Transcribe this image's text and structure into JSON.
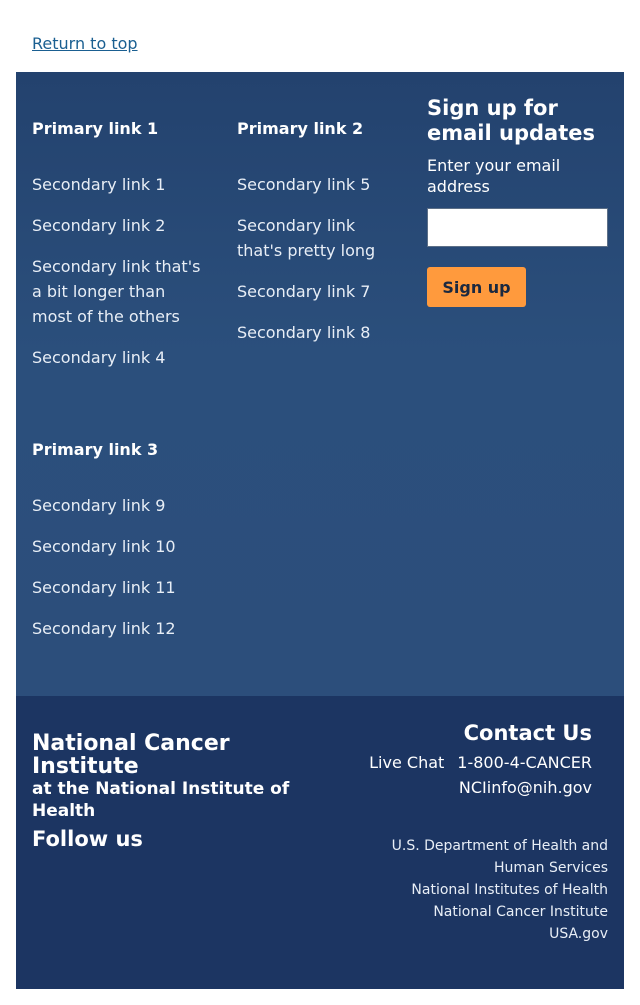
{
  "return_to_top": "Return to top",
  "nav": {
    "columns": [
      {
        "primary": "Primary link 1",
        "secondary": [
          "Secondary link 1",
          "Secondary link 2",
          "Secondary link that's a bit longer than most of the others",
          "Secondary link 4"
        ]
      },
      {
        "primary": "Primary link 2",
        "secondary": [
          "Secondary link 5",
          "Secondary link that's pretty long",
          "Secondary link 7",
          "Secondary link 8"
        ]
      },
      {
        "primary": "Primary link 3",
        "secondary": [
          "Secondary link 9",
          "Secondary link 10",
          "Secondary link 11",
          "Secondary link 12"
        ]
      }
    ]
  },
  "signup": {
    "heading": "Sign up for email updates",
    "email_label": "Enter your email address",
    "email_value": "",
    "button_label": "Sign up"
  },
  "org": {
    "name": "National Cancer Institute",
    "subtitle": "at the National Institute of Health",
    "follow_us": "Follow us"
  },
  "contact": {
    "heading": "Contact Us",
    "live_chat": "Live Chat",
    "phone": "1-800-4-CANCER",
    "email": "NCIinfo@nih.gov"
  },
  "gov_links": [
    "U.S. Department of Health and Human Services",
    "National Institutes of Health",
    "National Cancer Institute",
    "USA.gov"
  ],
  "colors": {
    "primary_footer": "#2b4f7c",
    "secondary_footer": "#1c3562",
    "signup_button": "#ff9a3d",
    "link": "#1a5f91"
  }
}
